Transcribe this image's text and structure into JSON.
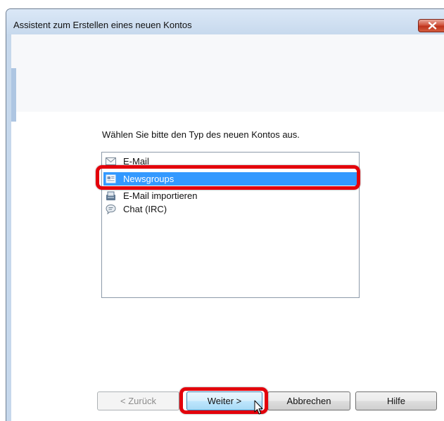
{
  "window": {
    "title": "Assistent zum Erstellen eines neuen Kontos"
  },
  "wizard": {
    "prompt": "Wählen Sie bitte den Typ des neuen Kontos aus.",
    "account_types": [
      {
        "label": "E-Mail",
        "icon": "envelope-icon",
        "selected": false
      },
      {
        "label": "Newsgroups",
        "icon": "newsgroup-icon",
        "selected": true
      },
      {
        "label": "E-Mail importieren",
        "icon": "import-icon",
        "selected": false
      },
      {
        "label": "Chat (IRC)",
        "icon": "chat-icon",
        "selected": false
      }
    ]
  },
  "buttons": {
    "back": "< Zurück",
    "next": "Weiter >",
    "cancel": "Abbrechen",
    "help": "Hilfe"
  },
  "colors": {
    "selection": "#3399ff",
    "highlight": "#e3000b",
    "titlebar": "#c6d8ec",
    "close_button": "#c7412c"
  }
}
